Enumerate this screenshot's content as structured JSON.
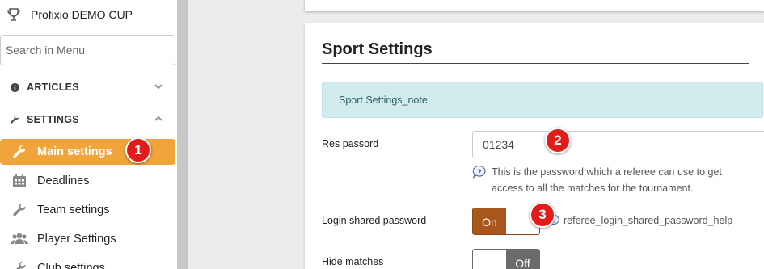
{
  "sidebar": {
    "app_title": "Profixio DEMO CUP",
    "search": {
      "placeholder": "Search in Menu",
      "value": ""
    },
    "sections": [
      {
        "label": "ARTICLES",
        "icon": "info-circle-icon",
        "chevron": "chevron-down-icon"
      },
      {
        "label": "SETTINGS",
        "icon": "wrench-icon",
        "chevron": "chevron-up-icon"
      }
    ],
    "items": [
      {
        "label": "Main settings",
        "icon": "wrench-icon",
        "active": true
      },
      {
        "label": "Deadlines",
        "icon": "calendar-icon"
      },
      {
        "label": "Team settings",
        "icon": "wrench-icon"
      },
      {
        "label": "Player Settings",
        "icon": "users-icon"
      },
      {
        "label": "Club settings",
        "icon": "wrench-icon"
      }
    ]
  },
  "badges": [
    "1",
    "2",
    "3"
  ],
  "card": {
    "title": "Sport Settings",
    "note": "Sport Settings_note",
    "fields": [
      {
        "label": "Res passord",
        "value": "01234",
        "help": "This is the password which a referee can use to get access to all the matches for the tournament."
      },
      {
        "label": "Login shared password",
        "toggle_label": "On",
        "help": "referee_login_shared_password_help"
      },
      {
        "label": "Hide matches",
        "toggle_label": "Off"
      }
    ]
  },
  "colors": {
    "active_menu": "#f0a43a",
    "badge": "#e21b1b",
    "toggle_on": "#a8561b",
    "toggle_off": "#6b6b6b",
    "note_bg": "#d2ecee"
  }
}
